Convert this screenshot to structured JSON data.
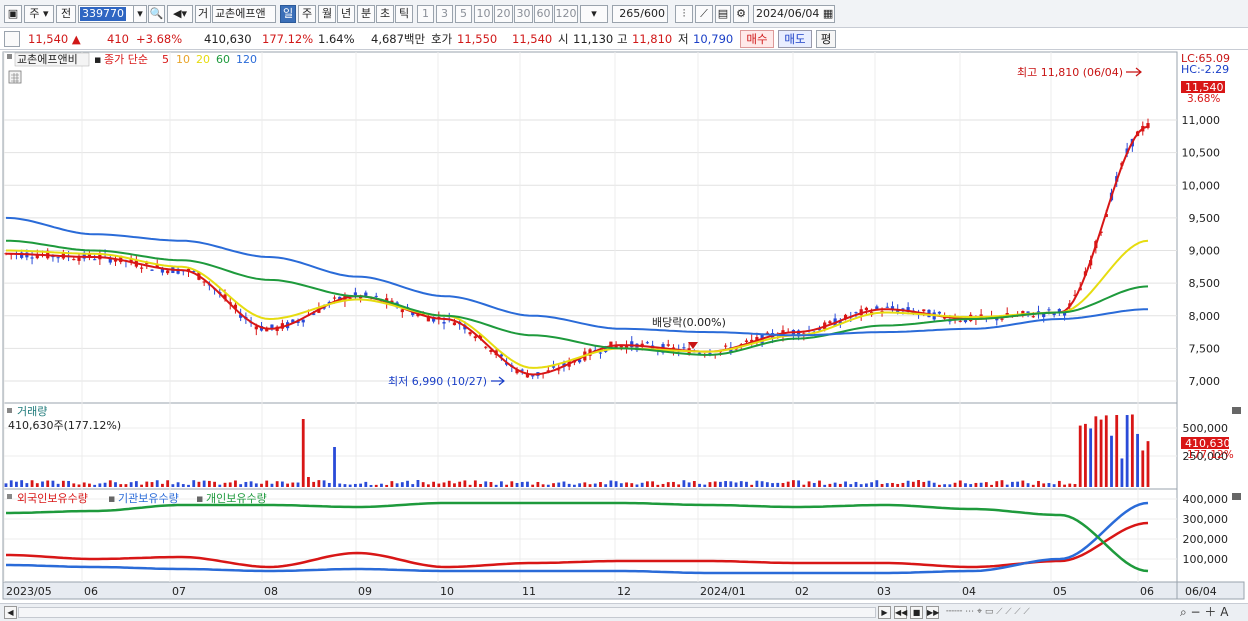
{
  "toolbar": {
    "market": "주",
    "prev": "전",
    "stock_code": "339770",
    "stock_name_prefix": "거",
    "stock_name": "교촌에프앤",
    "periods": [
      "일",
      "주",
      "월",
      "년",
      "분",
      "초",
      "틱"
    ],
    "active_period": "일",
    "intervals": [
      "1",
      "3",
      "5",
      "10",
      "20",
      "30",
      "60",
      "120"
    ],
    "count": "265",
    "count_max": "/600",
    "date": "2024/06/04"
  },
  "quote": {
    "price": "11,540",
    "change": "410",
    "change_pct": "+3.68%",
    "volume": "410,630",
    "volume_ratio": "177.12%",
    "turnover": "1.64%",
    "amount": "4,687백만",
    "ask_label": "호가",
    "ask": "11,550",
    "bid": "11,540",
    "open_label": "시",
    "open": "11,130",
    "high_label": "고",
    "high": "11,810",
    "low_label": "저",
    "low": "10,790",
    "buy_btn": "매수",
    "sell_btn": "매도",
    "eval_btn": "평"
  },
  "price_panel": {
    "name": "교촌에프앤비",
    "legend_prefix": "종가 단순",
    "ma_labels": [
      "5",
      "10",
      "20",
      "60",
      "120"
    ],
    "ma_colors": [
      "#d81616",
      "#e8a52a",
      "#e6dc10",
      "#1e9a3c",
      "#2a6bd8"
    ],
    "lc": "LC:65.09",
    "hc": "HC:-2.29",
    "current_price": "11,540",
    "current_pct": "3.68%",
    "high_annotation": "최고 11,810 (06/04)",
    "low_annotation": "최저 6,990 (10/27)",
    "dividend_annotation": "배당락(0.00%)",
    "y_ticks": [
      "11,000",
      "10,500",
      "10,000",
      "9,500",
      "9,000",
      "8,500",
      "8,000",
      "7,500",
      "7,000"
    ]
  },
  "volume_panel": {
    "title": "거래량",
    "value": "410,630주(177.12%)",
    "current": "410,630",
    "current_pct": "177.12%",
    "y_ticks": [
      "500,000",
      "250,000"
    ]
  },
  "holding_panel": {
    "legend": [
      "외국인보유수량",
      "기관보유수량",
      "개인보유수량"
    ],
    "colors": [
      "#d81616",
      "#2a6bd8",
      "#1e9a3c"
    ],
    "y_ticks": [
      "400,000",
      "300,000",
      "200,000",
      "100,000"
    ]
  },
  "x_axis": {
    "labels": [
      "2023/05",
      "06",
      "07",
      "08",
      "09",
      "10",
      "11",
      "12",
      "2024/01",
      "02",
      "03",
      "04",
      "05",
      "06"
    ],
    "last": "06/04"
  },
  "chart_data": {
    "type": "line",
    "title": "",
    "ylim": [
      6800,
      12000
    ],
    "x": [
      "2023/05",
      "06",
      "07",
      "08",
      "09",
      "10",
      "11",
      "12",
      "2024/01",
      "02",
      "03",
      "04",
      "05",
      "06"
    ],
    "series": [
      {
        "name": "5",
        "values": [
          8950,
          8900,
          8700,
          7800,
          8300,
          7950,
          7100,
          7550,
          7450,
          7750,
          8100,
          7950,
          8050,
          10900
        ]
      },
      {
        "name": "20",
        "values": [
          9000,
          8950,
          8750,
          7950,
          8250,
          8000,
          7200,
          7500,
          7450,
          7700,
          8050,
          7980,
          8050,
          9150
        ]
      },
      {
        "name": "60",
        "values": [
          9150,
          9000,
          8850,
          8550,
          8300,
          8000,
          7700,
          7500,
          7400,
          7650,
          7850,
          7950,
          8050,
          8450
        ]
      },
      {
        "name": "120",
        "values": [
          9500,
          9250,
          9150,
          8900,
          8600,
          8300,
          8000,
          7800,
          7750,
          7700,
          7750,
          7800,
          7950,
          8100
        ]
      },
      {
        "name": "외국인보유수량",
        "values": [
          120000,
          100000,
          110000,
          60000,
          130000,
          60000,
          80000,
          90000,
          90000,
          80000,
          80000,
          60000,
          90000,
          280000
        ]
      },
      {
        "name": "기관보유수량",
        "values": [
          70000,
          60000,
          50000,
          40000,
          50000,
          40000,
          40000,
          40000,
          30000,
          30000,
          30000,
          40000,
          100000,
          380000
        ]
      },
      {
        "name": "개인보유수량",
        "values": [
          330000,
          340000,
          370000,
          370000,
          360000,
          380000,
          380000,
          380000,
          370000,
          360000,
          370000,
          350000,
          320000,
          40000
        ]
      }
    ]
  }
}
